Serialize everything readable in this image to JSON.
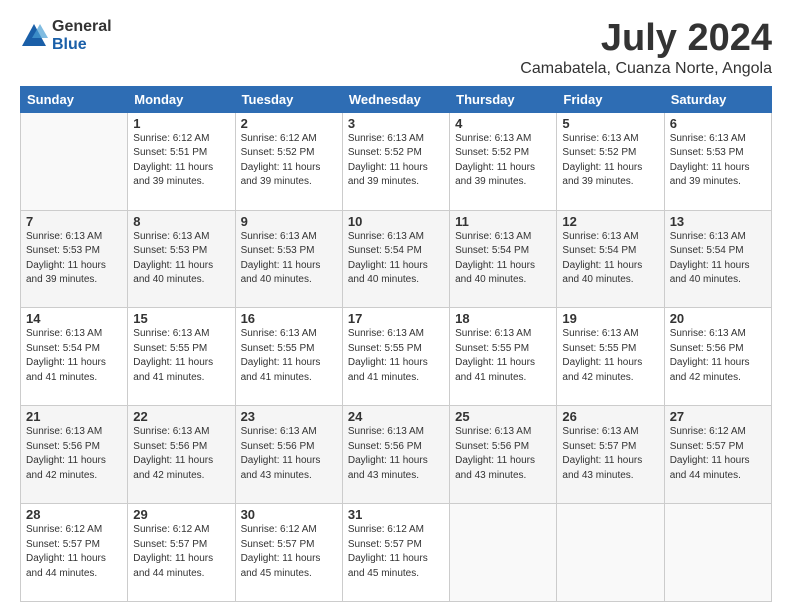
{
  "logo": {
    "general": "General",
    "blue": "Blue"
  },
  "title": "July 2024",
  "subtitle": "Camabatela, Cuanza Norte, Angola",
  "days_of_week": [
    "Sunday",
    "Monday",
    "Tuesday",
    "Wednesday",
    "Thursday",
    "Friday",
    "Saturday"
  ],
  "weeks": [
    [
      {
        "day": "",
        "info": ""
      },
      {
        "day": "1",
        "info": "Sunrise: 6:12 AM\nSunset: 5:51 PM\nDaylight: 11 hours\nand 39 minutes."
      },
      {
        "day": "2",
        "info": "Sunrise: 6:12 AM\nSunset: 5:52 PM\nDaylight: 11 hours\nand 39 minutes."
      },
      {
        "day": "3",
        "info": "Sunrise: 6:13 AM\nSunset: 5:52 PM\nDaylight: 11 hours\nand 39 minutes."
      },
      {
        "day": "4",
        "info": "Sunrise: 6:13 AM\nSunset: 5:52 PM\nDaylight: 11 hours\nand 39 minutes."
      },
      {
        "day": "5",
        "info": "Sunrise: 6:13 AM\nSunset: 5:52 PM\nDaylight: 11 hours\nand 39 minutes."
      },
      {
        "day": "6",
        "info": "Sunrise: 6:13 AM\nSunset: 5:53 PM\nDaylight: 11 hours\nand 39 minutes."
      }
    ],
    [
      {
        "day": "7",
        "info": "Sunrise: 6:13 AM\nSunset: 5:53 PM\nDaylight: 11 hours\nand 39 minutes."
      },
      {
        "day": "8",
        "info": "Sunrise: 6:13 AM\nSunset: 5:53 PM\nDaylight: 11 hours\nand 40 minutes."
      },
      {
        "day": "9",
        "info": "Sunrise: 6:13 AM\nSunset: 5:53 PM\nDaylight: 11 hours\nand 40 minutes."
      },
      {
        "day": "10",
        "info": "Sunrise: 6:13 AM\nSunset: 5:54 PM\nDaylight: 11 hours\nand 40 minutes."
      },
      {
        "day": "11",
        "info": "Sunrise: 6:13 AM\nSunset: 5:54 PM\nDaylight: 11 hours\nand 40 minutes."
      },
      {
        "day": "12",
        "info": "Sunrise: 6:13 AM\nSunset: 5:54 PM\nDaylight: 11 hours\nand 40 minutes."
      },
      {
        "day": "13",
        "info": "Sunrise: 6:13 AM\nSunset: 5:54 PM\nDaylight: 11 hours\nand 40 minutes."
      }
    ],
    [
      {
        "day": "14",
        "info": "Sunrise: 6:13 AM\nSunset: 5:54 PM\nDaylight: 11 hours\nand 41 minutes."
      },
      {
        "day": "15",
        "info": "Sunrise: 6:13 AM\nSunset: 5:55 PM\nDaylight: 11 hours\nand 41 minutes."
      },
      {
        "day": "16",
        "info": "Sunrise: 6:13 AM\nSunset: 5:55 PM\nDaylight: 11 hours\nand 41 minutes."
      },
      {
        "day": "17",
        "info": "Sunrise: 6:13 AM\nSunset: 5:55 PM\nDaylight: 11 hours\nand 41 minutes."
      },
      {
        "day": "18",
        "info": "Sunrise: 6:13 AM\nSunset: 5:55 PM\nDaylight: 11 hours\nand 41 minutes."
      },
      {
        "day": "19",
        "info": "Sunrise: 6:13 AM\nSunset: 5:55 PM\nDaylight: 11 hours\nand 42 minutes."
      },
      {
        "day": "20",
        "info": "Sunrise: 6:13 AM\nSunset: 5:56 PM\nDaylight: 11 hours\nand 42 minutes."
      }
    ],
    [
      {
        "day": "21",
        "info": "Sunrise: 6:13 AM\nSunset: 5:56 PM\nDaylight: 11 hours\nand 42 minutes."
      },
      {
        "day": "22",
        "info": "Sunrise: 6:13 AM\nSunset: 5:56 PM\nDaylight: 11 hours\nand 42 minutes."
      },
      {
        "day": "23",
        "info": "Sunrise: 6:13 AM\nSunset: 5:56 PM\nDaylight: 11 hours\nand 43 minutes."
      },
      {
        "day": "24",
        "info": "Sunrise: 6:13 AM\nSunset: 5:56 PM\nDaylight: 11 hours\nand 43 minutes."
      },
      {
        "day": "25",
        "info": "Sunrise: 6:13 AM\nSunset: 5:56 PM\nDaylight: 11 hours\nand 43 minutes."
      },
      {
        "day": "26",
        "info": "Sunrise: 6:13 AM\nSunset: 5:57 PM\nDaylight: 11 hours\nand 43 minutes."
      },
      {
        "day": "27",
        "info": "Sunrise: 6:12 AM\nSunset: 5:57 PM\nDaylight: 11 hours\nand 44 minutes."
      }
    ],
    [
      {
        "day": "28",
        "info": "Sunrise: 6:12 AM\nSunset: 5:57 PM\nDaylight: 11 hours\nand 44 minutes."
      },
      {
        "day": "29",
        "info": "Sunrise: 6:12 AM\nSunset: 5:57 PM\nDaylight: 11 hours\nand 44 minutes."
      },
      {
        "day": "30",
        "info": "Sunrise: 6:12 AM\nSunset: 5:57 PM\nDaylight: 11 hours\nand 45 minutes."
      },
      {
        "day": "31",
        "info": "Sunrise: 6:12 AM\nSunset: 5:57 PM\nDaylight: 11 hours\nand 45 minutes."
      },
      {
        "day": "",
        "info": ""
      },
      {
        "day": "",
        "info": ""
      },
      {
        "day": "",
        "info": ""
      }
    ]
  ]
}
